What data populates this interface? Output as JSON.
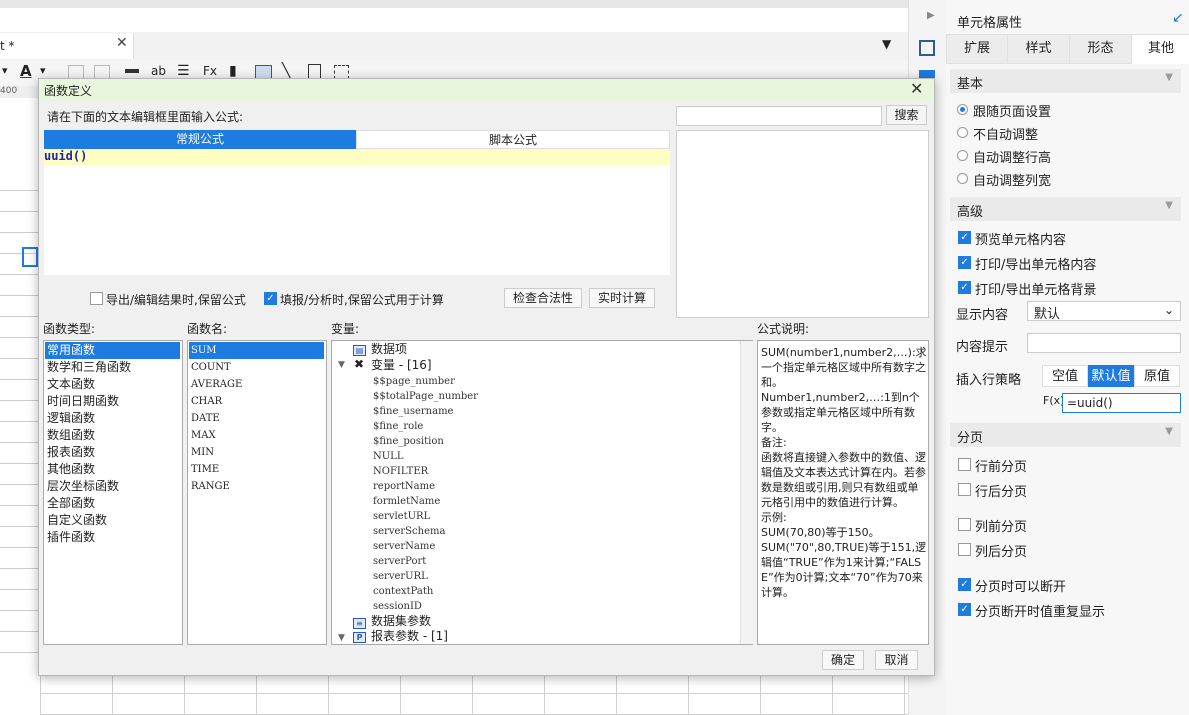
{
  "app": {
    "doc_tab_label": "t *",
    "doc_tab_close": "✕",
    "ruler_label": "400"
  },
  "right_panel": {
    "title": "单元格属性",
    "tabs": [
      "扩展",
      "样式",
      "形态",
      "其他"
    ],
    "active_tab": "其他",
    "basic": {
      "header": "基本",
      "options": [
        "跟随页面设置",
        "不自动调整",
        "自动调整行高",
        "自动调整列宽"
      ],
      "selected": "跟随页面设置"
    },
    "advanced": {
      "header": "高级",
      "checks": [
        "预览单元格内容",
        "打印/导出单元格内容",
        "打印/导出单元格背景"
      ],
      "display_label": "显示内容",
      "display_value": "默认",
      "hint_label": "内容提示",
      "hint_value": "",
      "insert_label": "插入行策略",
      "insert_options": [
        "空值",
        "默认值",
        "原值"
      ],
      "insert_selected": "默认值",
      "fx_label": "F(x)",
      "fx_value": "=uuid()"
    },
    "paging": {
      "header": "分页",
      "checks": [
        {
          "label": "行前分页",
          "checked": false
        },
        {
          "label": "行后分页",
          "checked": false
        },
        {
          "label": "列前分页",
          "checked": false
        },
        {
          "label": "列后分页",
          "checked": false
        },
        {
          "label": "分页时可以断开",
          "checked": true
        },
        {
          "label": "分页断开时值重复显示",
          "checked": true
        }
      ]
    }
  },
  "dialog": {
    "title": "函数定义",
    "close": "✕",
    "prompt": "请在下面的文本编辑框里面输入公式:",
    "mode_tabs": [
      "常规公式",
      "脚本公式"
    ],
    "formula": "uuid()",
    "search_button": "搜索",
    "option_keep_on_export": "导出/编辑结果时,保留公式",
    "option_keep_on_fill": "填报/分析时,保留公式用于计算",
    "option_keep_on_export_checked": false,
    "option_keep_on_fill_checked": true,
    "check_button": "检查合法性",
    "realtime_button": "实时计算",
    "category_header": "函数类型:",
    "name_header": "函数名:",
    "variable_header": "变量:",
    "desc_header": "公式说明:",
    "categories": [
      "常用函数",
      "数学和三角函数",
      "文本函数",
      "时间日期函数",
      "逻辑函数",
      "数组函数",
      "报表函数",
      "其他函数",
      "层次坐标函数",
      "全部函数",
      "自定义函数",
      "插件函数"
    ],
    "functions": [
      "SUM",
      "COUNT",
      "AVERAGE",
      "CHAR",
      "DATE",
      "MAX",
      "MIN",
      "TIME",
      "RANGE"
    ],
    "tree": {
      "data_item": "数据项",
      "variables_group": "变量 - [16]",
      "variables": [
        "$$page_number",
        "$$totalPage_number",
        "$fine_username",
        "$fine_role",
        "$fine_position",
        "NULL",
        "NOFILTER",
        "reportName",
        "formletName",
        "servletURL",
        "serverSchema",
        "serverName",
        "serverPort",
        "serverURL",
        "contextPath",
        "sessionID"
      ],
      "dataset_params": "数据集参数",
      "report_params": "报表参数 - [1]"
    },
    "description": "SUM(number1,number2,…):求一个指定单元格区域中所有数字之和。\nNumber1,number2,…:1到n个参数或指定单元格区域中所有数字。\n备注:\n函数将直接键入参数中的数值、逻辑值及文本表达式计算在内。若参数是数组或引用,则只有数组或单元格引用中的数值进行计算。\n示例:\nSUM(70,80)等于150。\nSUM(\"70\",80,TRUE)等于151,逻辑值“TRUE”作为1来计算;“FALSE”作为0计算;文本“70”作为70来计算。",
    "ok_button": "确定",
    "cancel_button": "取消"
  }
}
